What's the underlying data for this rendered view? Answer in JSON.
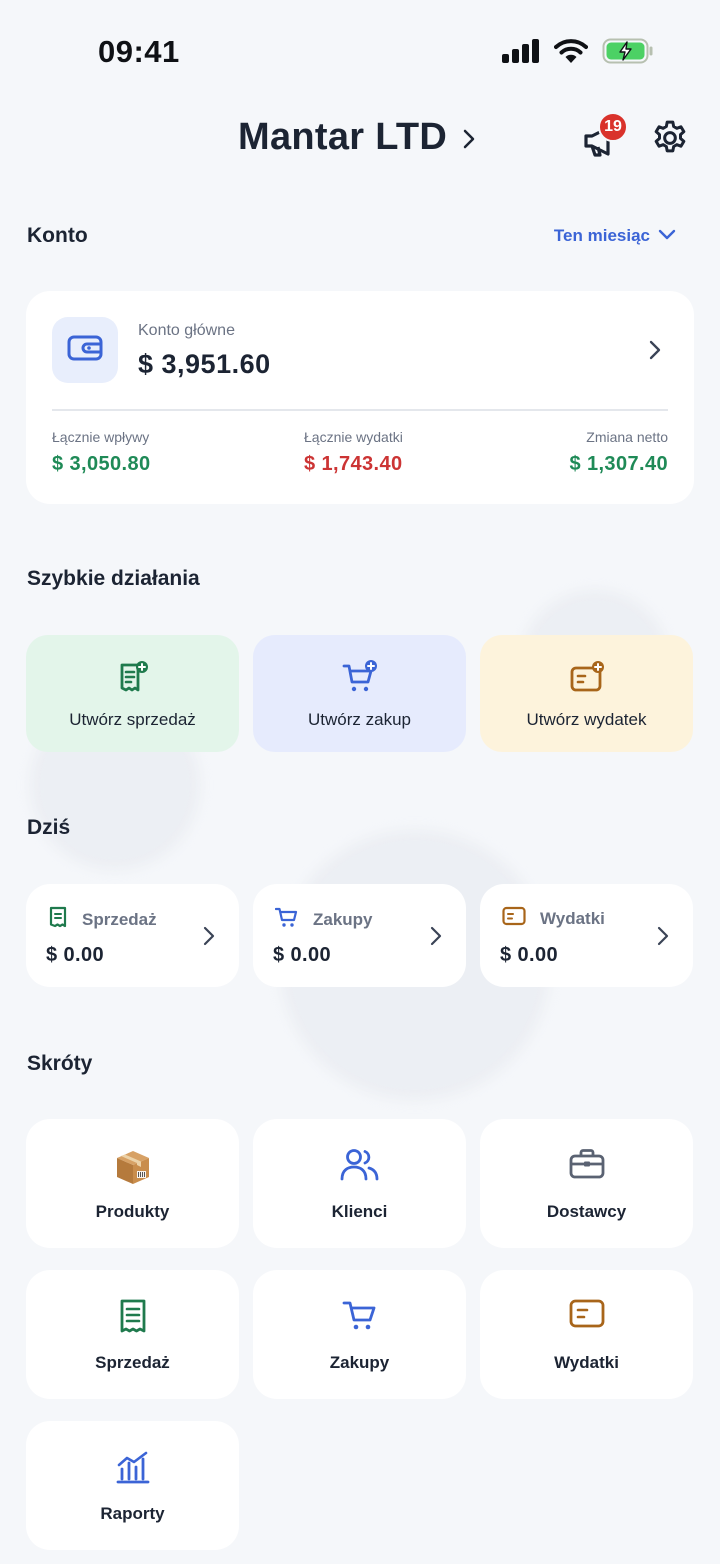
{
  "status_bar": {
    "time": "09:41"
  },
  "header": {
    "company_name": "Mantar LTD",
    "notifications_count": "19"
  },
  "account_section": {
    "title": "Konto",
    "period": "Ten miesiąc",
    "card": {
      "label": "Konto główne",
      "balance": "$ 3,951.60",
      "stats": [
        {
          "label": "Łącznie wpływy",
          "value": "$ 3,050.80",
          "color": "#1f8a57"
        },
        {
          "label": "Łącznie wydatki",
          "value": "$ 1,743.40",
          "color": "#cc3434"
        },
        {
          "label": "Zmiana netto",
          "value": "$ 1,307.40",
          "color": "#1f8a57"
        }
      ]
    }
  },
  "quick_actions": {
    "title": "Szybkie działania",
    "items": [
      {
        "label": "Utwórz sprzedaż",
        "icon": "receipt-plus-icon",
        "bg": "#e3f5ea",
        "accent": "#1f7a4d"
      },
      {
        "label": "Utwórz zakup",
        "icon": "cart-plus-icon",
        "bg": "#e6ebfd",
        "accent": "#3b64d6"
      },
      {
        "label": "Utwórz wydatek",
        "icon": "expense-plus-icon",
        "bg": "#fdf3dc",
        "accent": "#a8651a"
      }
    ]
  },
  "today": {
    "title": "Dziś",
    "items": [
      {
        "label": "Sprzedaż",
        "value": "$ 0.00",
        "icon": "receipt-icon"
      },
      {
        "label": "Zakupy",
        "value": "$ 0.00",
        "icon": "cart-icon"
      },
      {
        "label": "Wydatki",
        "value": "$ 0.00",
        "icon": "expense-icon"
      }
    ]
  },
  "shortcuts": {
    "title": "Skróty",
    "items": [
      {
        "label": "Produkty",
        "icon": "package-icon"
      },
      {
        "label": "Klienci",
        "icon": "users-icon"
      },
      {
        "label": "Dostawcy",
        "icon": "briefcase-icon"
      },
      {
        "label": "Sprzedaż",
        "icon": "receipt-icon"
      },
      {
        "label": "Zakupy",
        "icon": "cart-icon"
      },
      {
        "label": "Wydatki",
        "icon": "expense-icon"
      },
      {
        "label": "Raporty",
        "icon": "chart-icon"
      }
    ]
  }
}
